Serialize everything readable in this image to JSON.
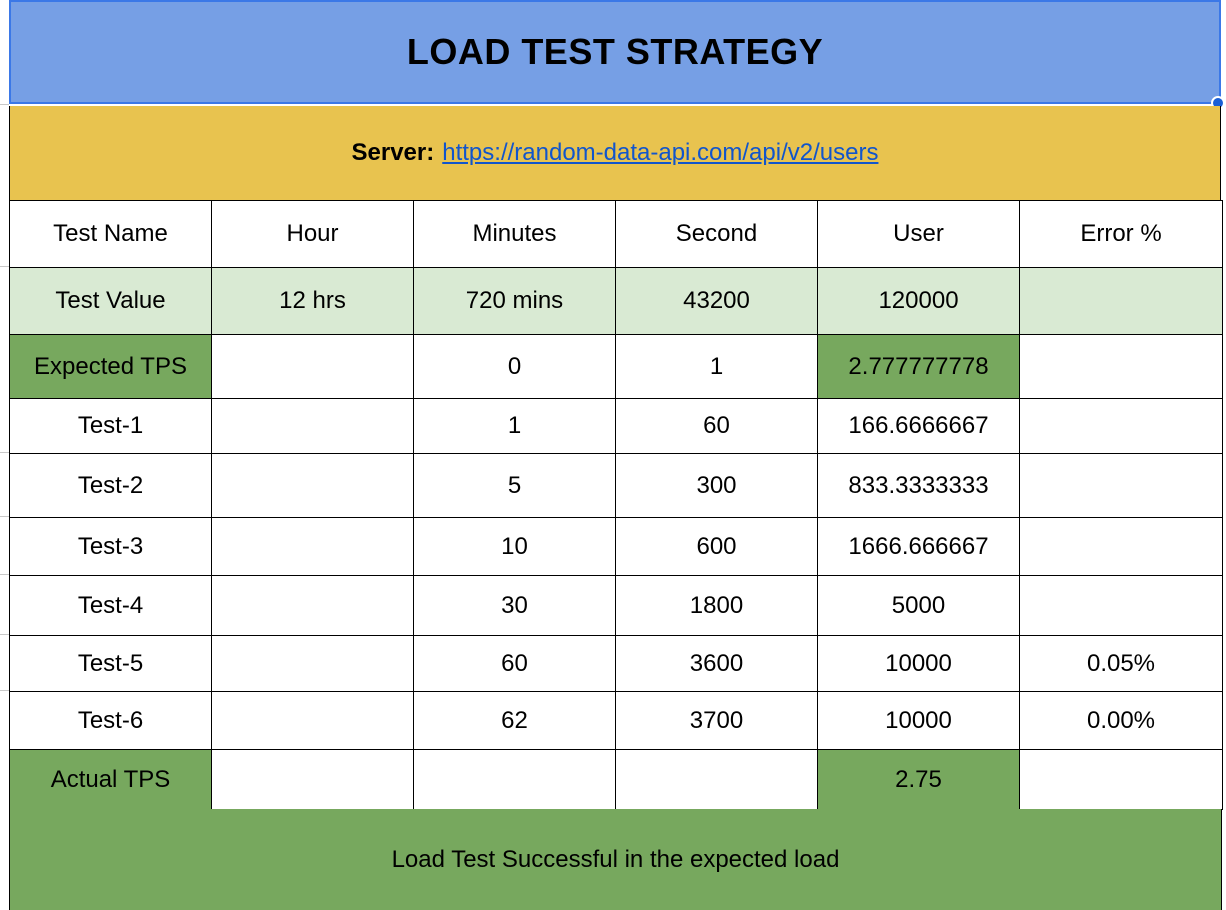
{
  "title": "LOAD TEST STRATEGY",
  "server": {
    "label": "Server:",
    "url": "https://random-data-api.com/api/v2/users"
  },
  "header": [
    "Test Name",
    "Hour",
    "Minutes",
    "Second",
    "User",
    "Error %"
  ],
  "rows": [
    [
      "Test Value",
      "12 hrs",
      "720 mins",
      "43200",
      "120000",
      ""
    ],
    [
      "Expected TPS",
      "",
      "0",
      "1",
      "2.777777778",
      ""
    ],
    [
      "Test-1",
      "",
      "1",
      "60",
      "166.6666667",
      ""
    ],
    [
      "Test-2",
      "",
      "5",
      "300",
      "833.3333333",
      ""
    ],
    [
      "Test-3",
      "",
      "10",
      "600",
      "1666.666667",
      ""
    ],
    [
      "Test-4",
      "",
      "30",
      "1800",
      "5000",
      ""
    ],
    [
      "Test-5",
      "",
      "60",
      "3600",
      "10000",
      "0.05%"
    ],
    [
      "Test-6",
      "",
      "62",
      "3700",
      "10000",
      "0.00%"
    ],
    [
      "Actual TPS",
      "",
      "",
      "",
      "2.75",
      ""
    ]
  ],
  "footer": "Load Test Successful in the expected load",
  "colors": {
    "title_bg": "#769fe5",
    "server_bg": "#e8c34f",
    "light_green": "#d9ead3",
    "green": "#77a85e",
    "link": "#1155cc"
  }
}
